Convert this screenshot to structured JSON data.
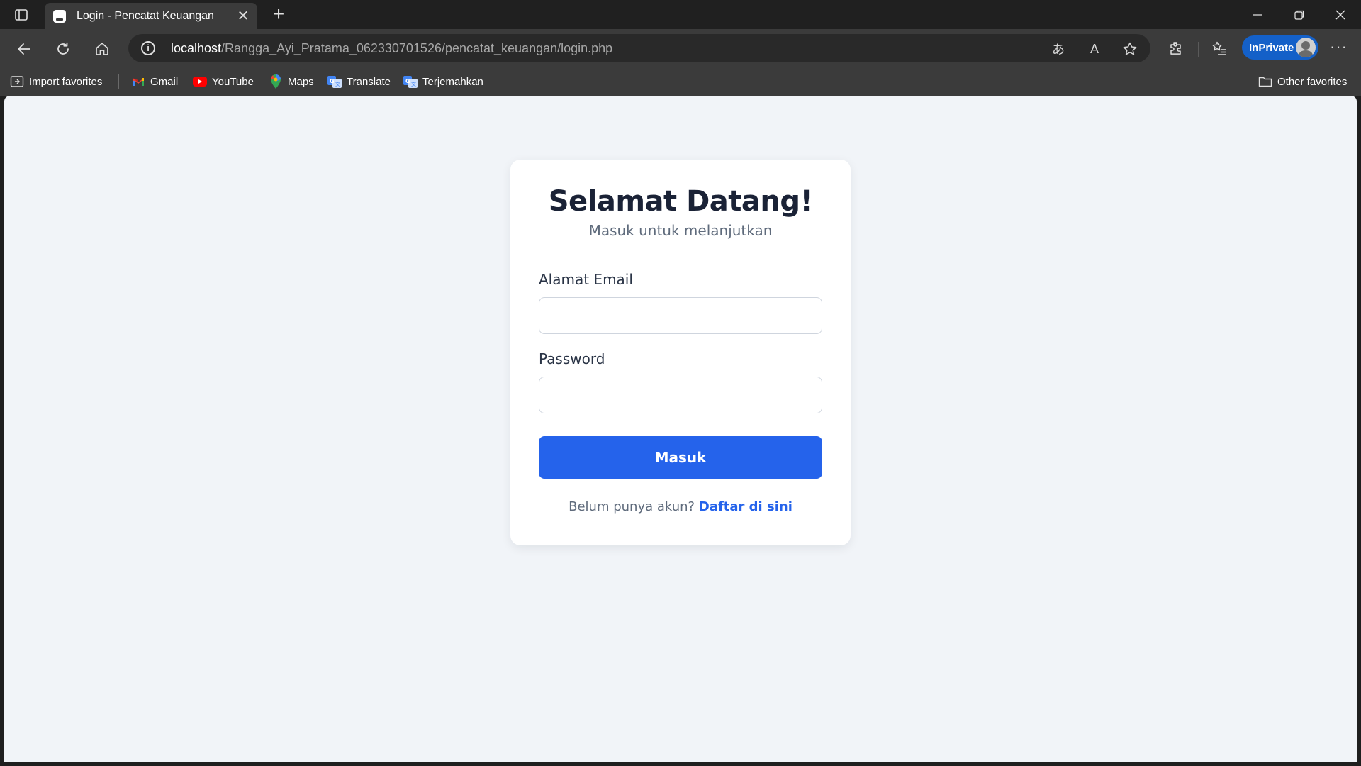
{
  "browser": {
    "tab": {
      "title": "Login - Pencatat Keuangan"
    },
    "address": {
      "host": "localhost",
      "path": "/Rangga_Ayi_Pratama_062330701526/pencatat_keuangan/login.php"
    },
    "inprivate_label": "InPrivate",
    "bookmarks": [
      {
        "label": "Import favorites",
        "icon": "import-icon"
      },
      {
        "label": "Gmail",
        "icon": "gmail-icon"
      },
      {
        "label": "YouTube",
        "icon": "youtube-icon"
      },
      {
        "label": "Maps",
        "icon": "maps-icon"
      },
      {
        "label": "Translate",
        "icon": "translate-icon"
      },
      {
        "label": "Terjemahkan",
        "icon": "translate-icon"
      }
    ],
    "other_favorites": "Other favorites"
  },
  "login": {
    "title": "Selamat Datang!",
    "subtitle": "Masuk untuk melanjutkan",
    "email_label": "Alamat Email",
    "email_value": "",
    "password_label": "Password",
    "password_value": "",
    "submit_label": "Masuk",
    "register_prompt": "Belum punya akun?",
    "register_link": "Daftar di sini"
  },
  "colors": {
    "accent": "#2563eb",
    "page_bg": "#f1f4f8",
    "inprivate": "#1460c8"
  }
}
